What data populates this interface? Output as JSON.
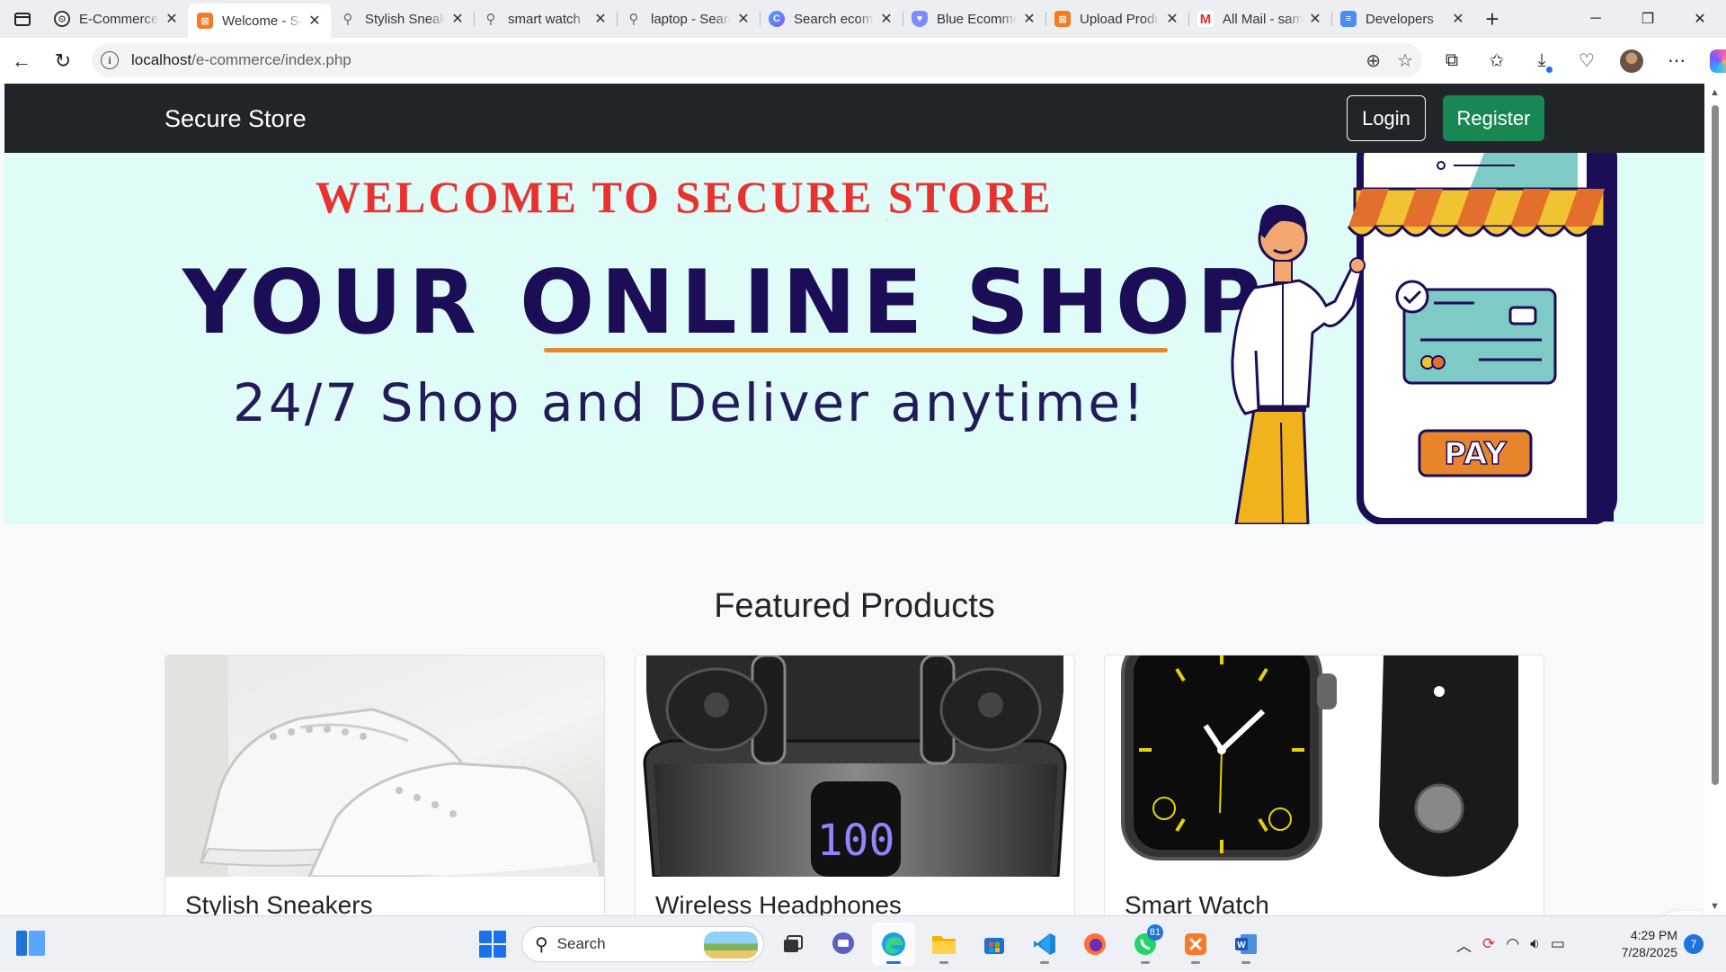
{
  "browser": {
    "tabs": [
      {
        "label": "E-Commerce",
        "favicon": "gear-icon",
        "active": false
      },
      {
        "label": "Welcome - Secure Store",
        "favicon": "xampp-icon",
        "active": true
      },
      {
        "label": "Stylish Sneakers",
        "favicon": "search-icon",
        "active": false
      },
      {
        "label": "smart watch",
        "favicon": "search-icon",
        "active": false
      },
      {
        "label": "laptop - Search",
        "favicon": "search-icon",
        "active": false
      },
      {
        "label": "Search ecommerce",
        "favicon": "copilot-icon",
        "active": false
      },
      {
        "label": "Blue Ecommerce",
        "favicon": "shield-icon",
        "active": false
      },
      {
        "label": "Upload Product",
        "favicon": "xampp-icon",
        "active": false
      },
      {
        "label": "All Mail - sam",
        "favicon": "gmail-icon",
        "active": false
      },
      {
        "label": "Developers",
        "favicon": "document-icon",
        "active": false
      }
    ],
    "url_host": "localhost",
    "url_path": "/e-commerce/index.php"
  },
  "site": {
    "brand": "Secure Store",
    "login_label": "Login",
    "register_label": "Register",
    "register_color": "#198754",
    "navbar_color": "#212529"
  },
  "hero": {
    "welcome": "WELCOME TO SECURE STORE",
    "headline": "YOUR ONLINE SHOP",
    "tagline": "24/7 Shop and Deliver anytime!",
    "pay_label": "PAY",
    "background_color": "#e0fcf8"
  },
  "featured": {
    "title": "Featured Products",
    "products": [
      {
        "name": "Stylish Sneakers",
        "image": "white-sneakers"
      },
      {
        "name": "Wireless Headphones",
        "image": "black-earbuds-case"
      },
      {
        "name": "Smart Watch",
        "image": "black-smartwatch"
      }
    ]
  },
  "taskbar": {
    "search_label": "Search",
    "whatsapp_badge": "81",
    "time": "4:29 PM",
    "date": "7/28/2025",
    "notification_count": "7"
  }
}
